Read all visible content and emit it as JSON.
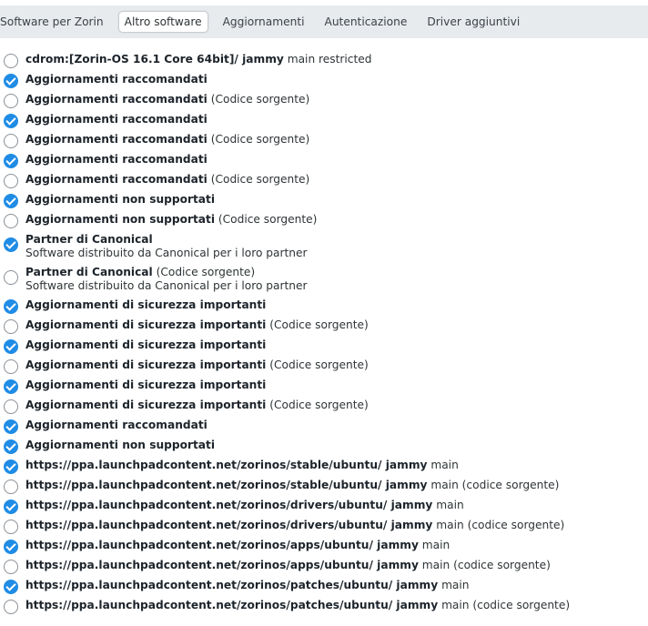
{
  "tabs": [
    {
      "label": "Software per Zorin",
      "active": false
    },
    {
      "label": "Altro software",
      "active": true
    },
    {
      "label": "Aggiornamenti",
      "active": false
    },
    {
      "label": "Autenticazione",
      "active": false
    },
    {
      "label": "Driver aggiuntivi",
      "active": false
    }
  ],
  "sources": [
    {
      "checked": false,
      "name": "cdrom:[Zorin-OS 16.1 Core 64bit]/ jammy",
      "suffix": "main restricted",
      "sub": ""
    },
    {
      "checked": true,
      "name": "Aggiornamenti raccomandati",
      "suffix": "",
      "sub": ""
    },
    {
      "checked": false,
      "name": "Aggiornamenti raccomandati",
      "suffix": "(Codice sorgente)",
      "sub": ""
    },
    {
      "checked": true,
      "name": "Aggiornamenti raccomandati",
      "suffix": "",
      "sub": ""
    },
    {
      "checked": false,
      "name": "Aggiornamenti raccomandati",
      "suffix": "(Codice sorgente)",
      "sub": ""
    },
    {
      "checked": true,
      "name": "Aggiornamenti raccomandati",
      "suffix": "",
      "sub": ""
    },
    {
      "checked": false,
      "name": "Aggiornamenti raccomandati",
      "suffix": "(Codice sorgente)",
      "sub": ""
    },
    {
      "checked": true,
      "name": "Aggiornamenti non supportati",
      "suffix": "",
      "sub": ""
    },
    {
      "checked": false,
      "name": "Aggiornamenti non supportati",
      "suffix": "(Codice sorgente)",
      "sub": ""
    },
    {
      "checked": true,
      "name": "Partner di Canonical",
      "suffix": "",
      "sub": "Software distribuito da Canonical per i loro partner"
    },
    {
      "checked": false,
      "name": "Partner di Canonical",
      "suffix": "(Codice sorgente)",
      "sub": "Software distribuito da Canonical per i loro partner"
    },
    {
      "checked": true,
      "name": "Aggiornamenti di sicurezza importanti",
      "suffix": "",
      "sub": ""
    },
    {
      "checked": false,
      "name": "Aggiornamenti di sicurezza importanti",
      "suffix": "(Codice sorgente)",
      "sub": ""
    },
    {
      "checked": true,
      "name": "Aggiornamenti di sicurezza importanti",
      "suffix": "",
      "sub": ""
    },
    {
      "checked": false,
      "name": "Aggiornamenti di sicurezza importanti",
      "suffix": "(Codice sorgente)",
      "sub": ""
    },
    {
      "checked": true,
      "name": "Aggiornamenti di sicurezza importanti",
      "suffix": "",
      "sub": ""
    },
    {
      "checked": false,
      "name": "Aggiornamenti di sicurezza importanti",
      "suffix": "(Codice sorgente)",
      "sub": ""
    },
    {
      "checked": true,
      "name": "Aggiornamenti raccomandati",
      "suffix": "",
      "sub": ""
    },
    {
      "checked": true,
      "name": "Aggiornamenti non supportati",
      "suffix": "",
      "sub": ""
    },
    {
      "checked": true,
      "name": "https://ppa.launchpadcontent.net/zorinos/stable/ubuntu/ jammy",
      "suffix": "main",
      "sub": ""
    },
    {
      "checked": false,
      "name": "https://ppa.launchpadcontent.net/zorinos/stable/ubuntu/ jammy",
      "suffix": "main (codice sorgente)",
      "sub": ""
    },
    {
      "checked": true,
      "name": "https://ppa.launchpadcontent.net/zorinos/drivers/ubuntu/ jammy",
      "suffix": "main",
      "sub": ""
    },
    {
      "checked": false,
      "name": "https://ppa.launchpadcontent.net/zorinos/drivers/ubuntu/ jammy",
      "suffix": "main (codice sorgente)",
      "sub": ""
    },
    {
      "checked": true,
      "name": "https://ppa.launchpadcontent.net/zorinos/apps/ubuntu/ jammy",
      "suffix": "main",
      "sub": ""
    },
    {
      "checked": false,
      "name": "https://ppa.launchpadcontent.net/zorinos/apps/ubuntu/ jammy",
      "suffix": "main (codice sorgente)",
      "sub": ""
    },
    {
      "checked": true,
      "name": "https://ppa.launchpadcontent.net/zorinos/patches/ubuntu/ jammy",
      "suffix": "main",
      "sub": ""
    },
    {
      "checked": false,
      "name": "https://ppa.launchpadcontent.net/zorinos/patches/ubuntu/ jammy",
      "suffix": "main (codice sorgente)",
      "sub": ""
    }
  ],
  "icons": {
    "checked": "checkbox-checked-icon",
    "unchecked": "checkbox-unchecked-icon"
  },
  "colors": {
    "accent": "#1f8ce6",
    "tabbar": "#e8ebee",
    "text": "#2e3436"
  }
}
